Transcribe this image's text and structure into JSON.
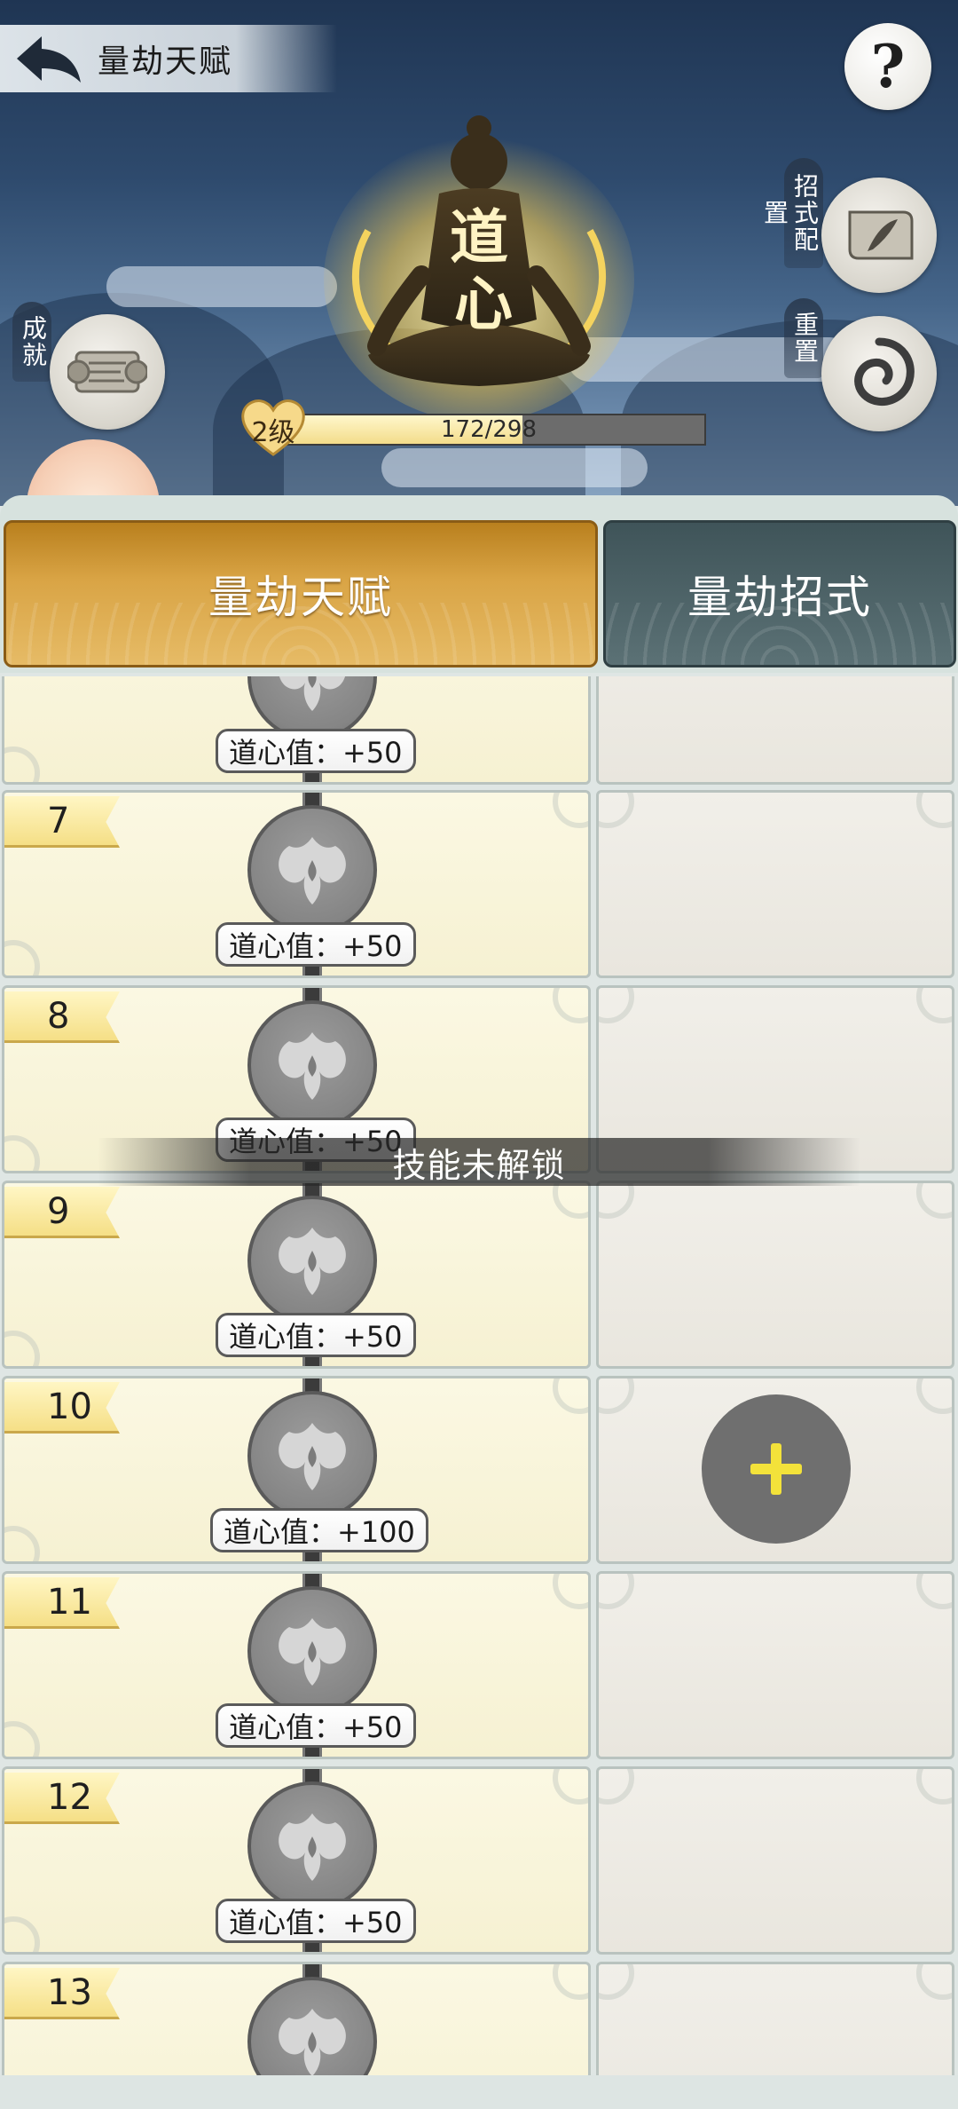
{
  "header": {
    "title": "量劫天赋",
    "help_symbol": "?",
    "avatar_chars": [
      "道",
      "心"
    ]
  },
  "level": {
    "label": "2级",
    "progress_text": "172/298",
    "current": 172,
    "max": 298
  },
  "side_buttons": {
    "achievement": "成就",
    "skill_config": "招式配置",
    "reset": "重置"
  },
  "tabs": [
    {
      "label": "量劫天赋",
      "active": true
    },
    {
      "label": "量劫招式",
      "active": false
    }
  ],
  "rows": [
    {
      "level": "",
      "value": "道心值：+50"
    },
    {
      "level": "7",
      "value": "道心值：+50"
    },
    {
      "level": "8",
      "value": "道心值：+50"
    },
    {
      "level": "9",
      "value": "道心值：+50"
    },
    {
      "level": "10",
      "value": "道心值：+100"
    },
    {
      "level": "11",
      "value": "道心值：+50"
    },
    {
      "level": "12",
      "value": "道心值：+50"
    },
    {
      "level": "13",
      "value": ""
    }
  ],
  "toast": "技能未解锁",
  "colors": {
    "active_tab": "#d9a445",
    "inactive_tab": "#4b6165",
    "plus_icon": "#f3e23a"
  }
}
